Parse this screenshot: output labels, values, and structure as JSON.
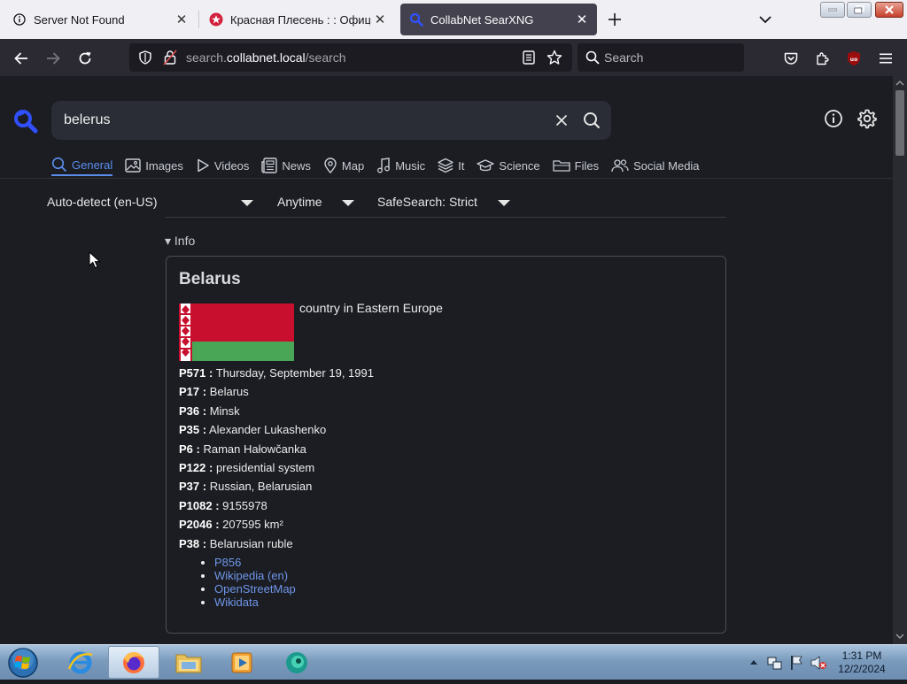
{
  "browser": {
    "tabs": [
      {
        "title": "Server Not Found",
        "active": false
      },
      {
        "title": "Красная Плесень : : Официал",
        "active": false
      },
      {
        "title": "CollabNet SearXNG",
        "active": true
      }
    ],
    "url": {
      "prefix": "search.",
      "host": "collabnet.local",
      "path": "/search"
    },
    "search_placeholder": "Search"
  },
  "page": {
    "query": "belerus",
    "categories": [
      {
        "label": "General",
        "icon": "search-icon",
        "active": true
      },
      {
        "label": "Images",
        "icon": "image-icon",
        "active": false
      },
      {
        "label": "Videos",
        "icon": "play-icon",
        "active": false
      },
      {
        "label": "News",
        "icon": "newspaper-icon",
        "active": false
      },
      {
        "label": "Map",
        "icon": "map-pin-icon",
        "active": false
      },
      {
        "label": "Music",
        "icon": "music-note-icon",
        "active": false
      },
      {
        "label": "It",
        "icon": "layers-icon",
        "active": false
      },
      {
        "label": "Science",
        "icon": "graduation-cap-icon",
        "active": false
      },
      {
        "label": "Files",
        "icon": "folder-icon",
        "active": false
      },
      {
        "label": "Social Media",
        "icon": "people-icon",
        "active": false
      }
    ],
    "filters": {
      "language": "Auto-detect (en-US)",
      "time": "Anytime",
      "safesearch": "SafeSearch: Strict"
    },
    "infobox": {
      "toggle_label": "Info",
      "title": "Belarus",
      "description": "country in Eastern Europe",
      "flag_colors": {
        "red": "#c8102e",
        "green": "#4aa657",
        "ornament": "#ffffff"
      },
      "attributes": [
        {
          "key": "P571 :",
          "value": "Thursday, September 19, 1991"
        },
        {
          "key": "P17 :",
          "value": "Belarus"
        },
        {
          "key": "P36 :",
          "value": "Minsk"
        },
        {
          "key": "P35 :",
          "value": "Alexander Lukashenko"
        },
        {
          "key": "P6 :",
          "value": "Raman Hałowčanka"
        },
        {
          "key": "P122 :",
          "value": "presidential system"
        },
        {
          "key": "P37 :",
          "value": "Russian, Belarusian"
        },
        {
          "key": "P1082 :",
          "value": "9155978"
        },
        {
          "key": "P2046 :",
          "value": "207595 km²"
        },
        {
          "key": "P38 :",
          "value": "Belarusian ruble"
        }
      ],
      "links": [
        "P856",
        "Wikipedia (en)",
        "OpenStreetMap",
        "Wikidata"
      ]
    }
  },
  "taskbar": {
    "apps": [
      "internet-explorer",
      "firefox",
      "file-explorer",
      "media-player",
      "app-icon"
    ],
    "clock": {
      "time": "1:31 PM",
      "date": "12/2/2024"
    }
  },
  "colors": {
    "accent": "#5a8dea",
    "page_bg": "#1b1d23",
    "link": "#6f96e8"
  }
}
